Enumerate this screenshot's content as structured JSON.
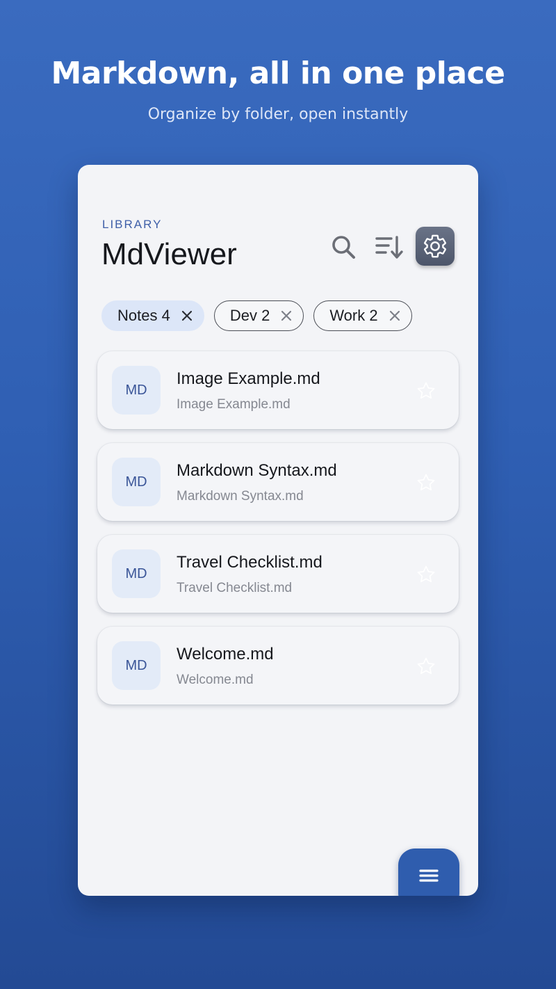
{
  "hero": {
    "title": "Markdown, all in one place",
    "subtitle": "Organize by folder, open instantly"
  },
  "header": {
    "eyebrow": "LIBRARY",
    "title": "MdViewer",
    "actions": [
      {
        "name": "search",
        "icon": "search-icon"
      },
      {
        "name": "sort",
        "icon": "sort-icon"
      },
      {
        "name": "settings",
        "icon": "gear-icon"
      }
    ]
  },
  "filters": [
    {
      "label": "Notes 4",
      "active": true
    },
    {
      "label": "Dev 2",
      "active": false
    },
    {
      "label": "Work 2",
      "active": false
    }
  ],
  "files": [
    {
      "badge": "MD",
      "title": "Image Example.md",
      "subtitle": "Image Example.md",
      "starred": false
    },
    {
      "badge": "MD",
      "title": "Markdown Syntax.md",
      "subtitle": "Markdown Syntax.md",
      "starred": false
    },
    {
      "badge": "MD",
      "title": "Travel Checklist.md",
      "subtitle": "Travel Checklist.md",
      "starred": false
    },
    {
      "badge": "MD",
      "title": "Welcome.md",
      "subtitle": "Welcome.md",
      "starred": false
    }
  ],
  "fab": {
    "icon": "menu-icon"
  },
  "colors": {
    "background": "#2f5fb3",
    "accent": "#2f5dae",
    "chip_active": "#dce6f8",
    "settings_button": "#5a6377"
  }
}
